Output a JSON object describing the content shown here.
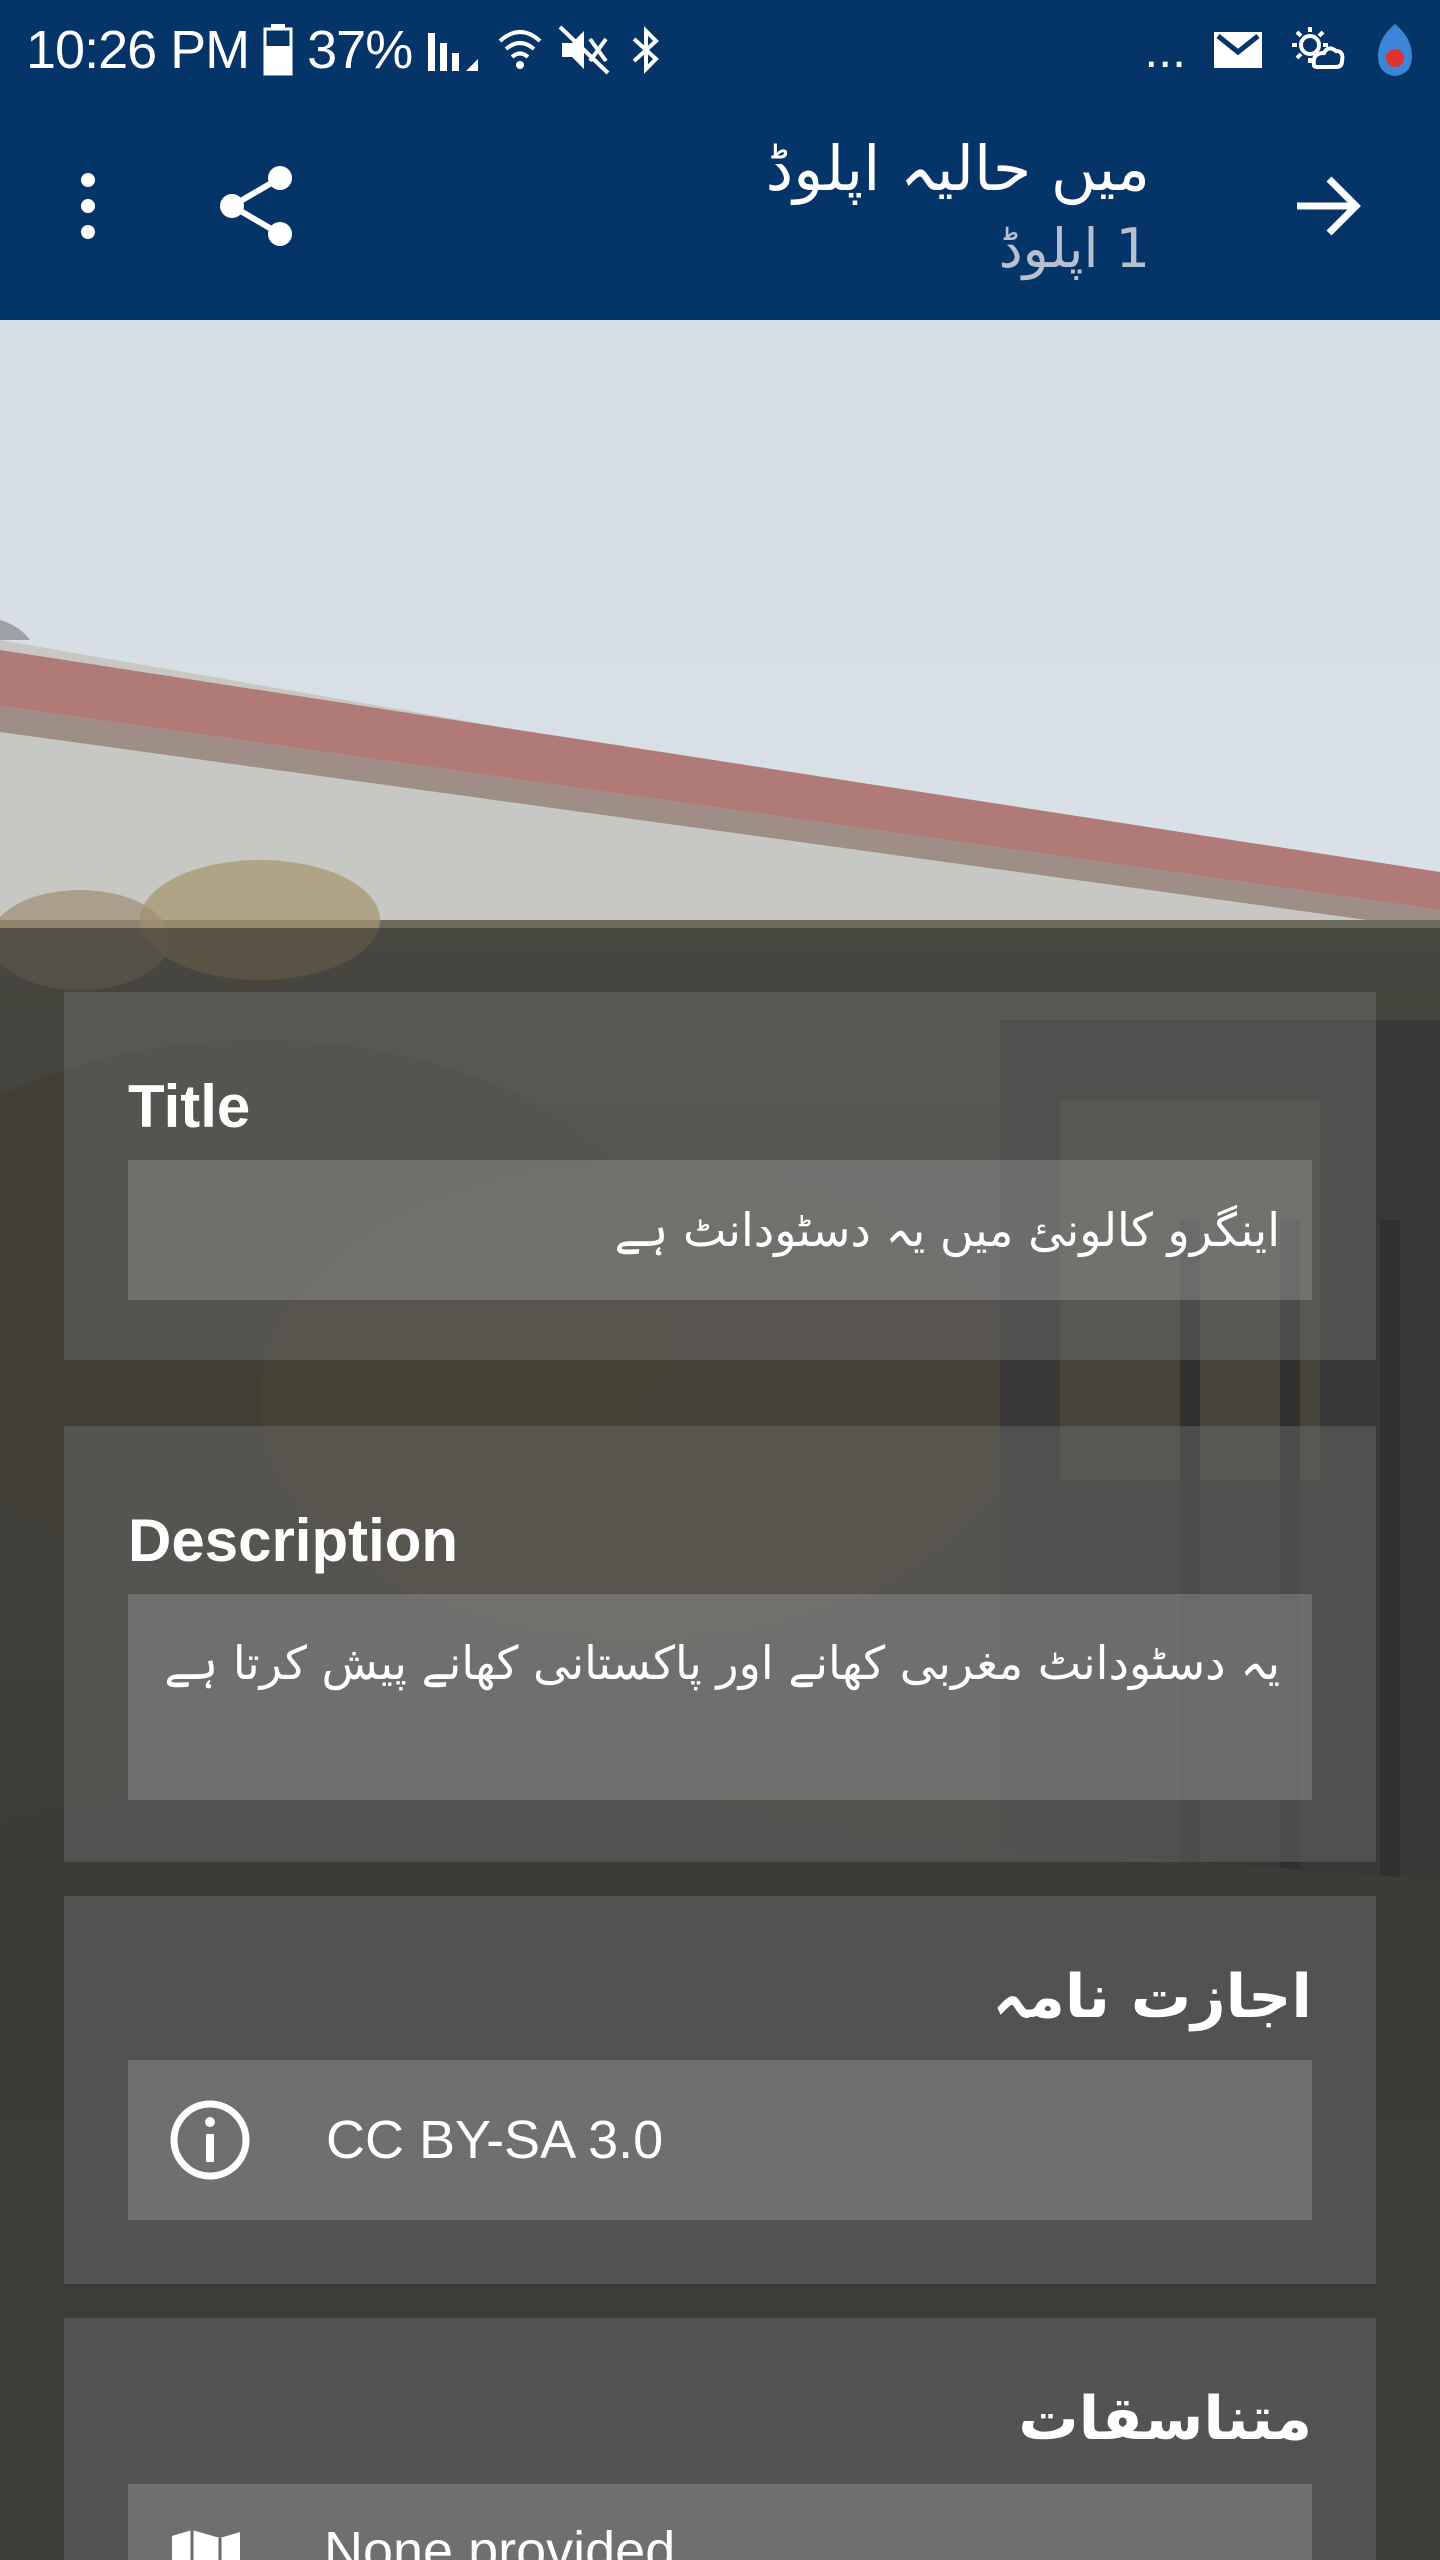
{
  "status_bar": {
    "time": "10:26 PM",
    "battery": "37%",
    "overflow": "..."
  },
  "toolbar": {
    "title": "میں حالیہ اپلوڈ",
    "subtitle": "1 اپلوڈ"
  },
  "cards": {
    "title": {
      "label": "Title",
      "value": "اینگرو کالونئ میں یہ دسٹودانٹ ہے"
    },
    "description": {
      "label": "Description",
      "value": "یہ دسٹودانٹ مغربی کھانے اور پاکستانی کھانے پیش کرتا ہے"
    },
    "license": {
      "label": "اجازت نامہ",
      "value": "CC BY-SA 3.0"
    },
    "coordinates": {
      "label": "متناسقات",
      "value": "None provided"
    }
  },
  "icons": {
    "menu": "more-vert-icon",
    "share": "share-icon",
    "forward": "arrow-forward-icon",
    "info": "info-icon",
    "map": "map-icon"
  },
  "colors": {
    "app_bar": "#043468",
    "subtitle": "#b7c0cf"
  }
}
